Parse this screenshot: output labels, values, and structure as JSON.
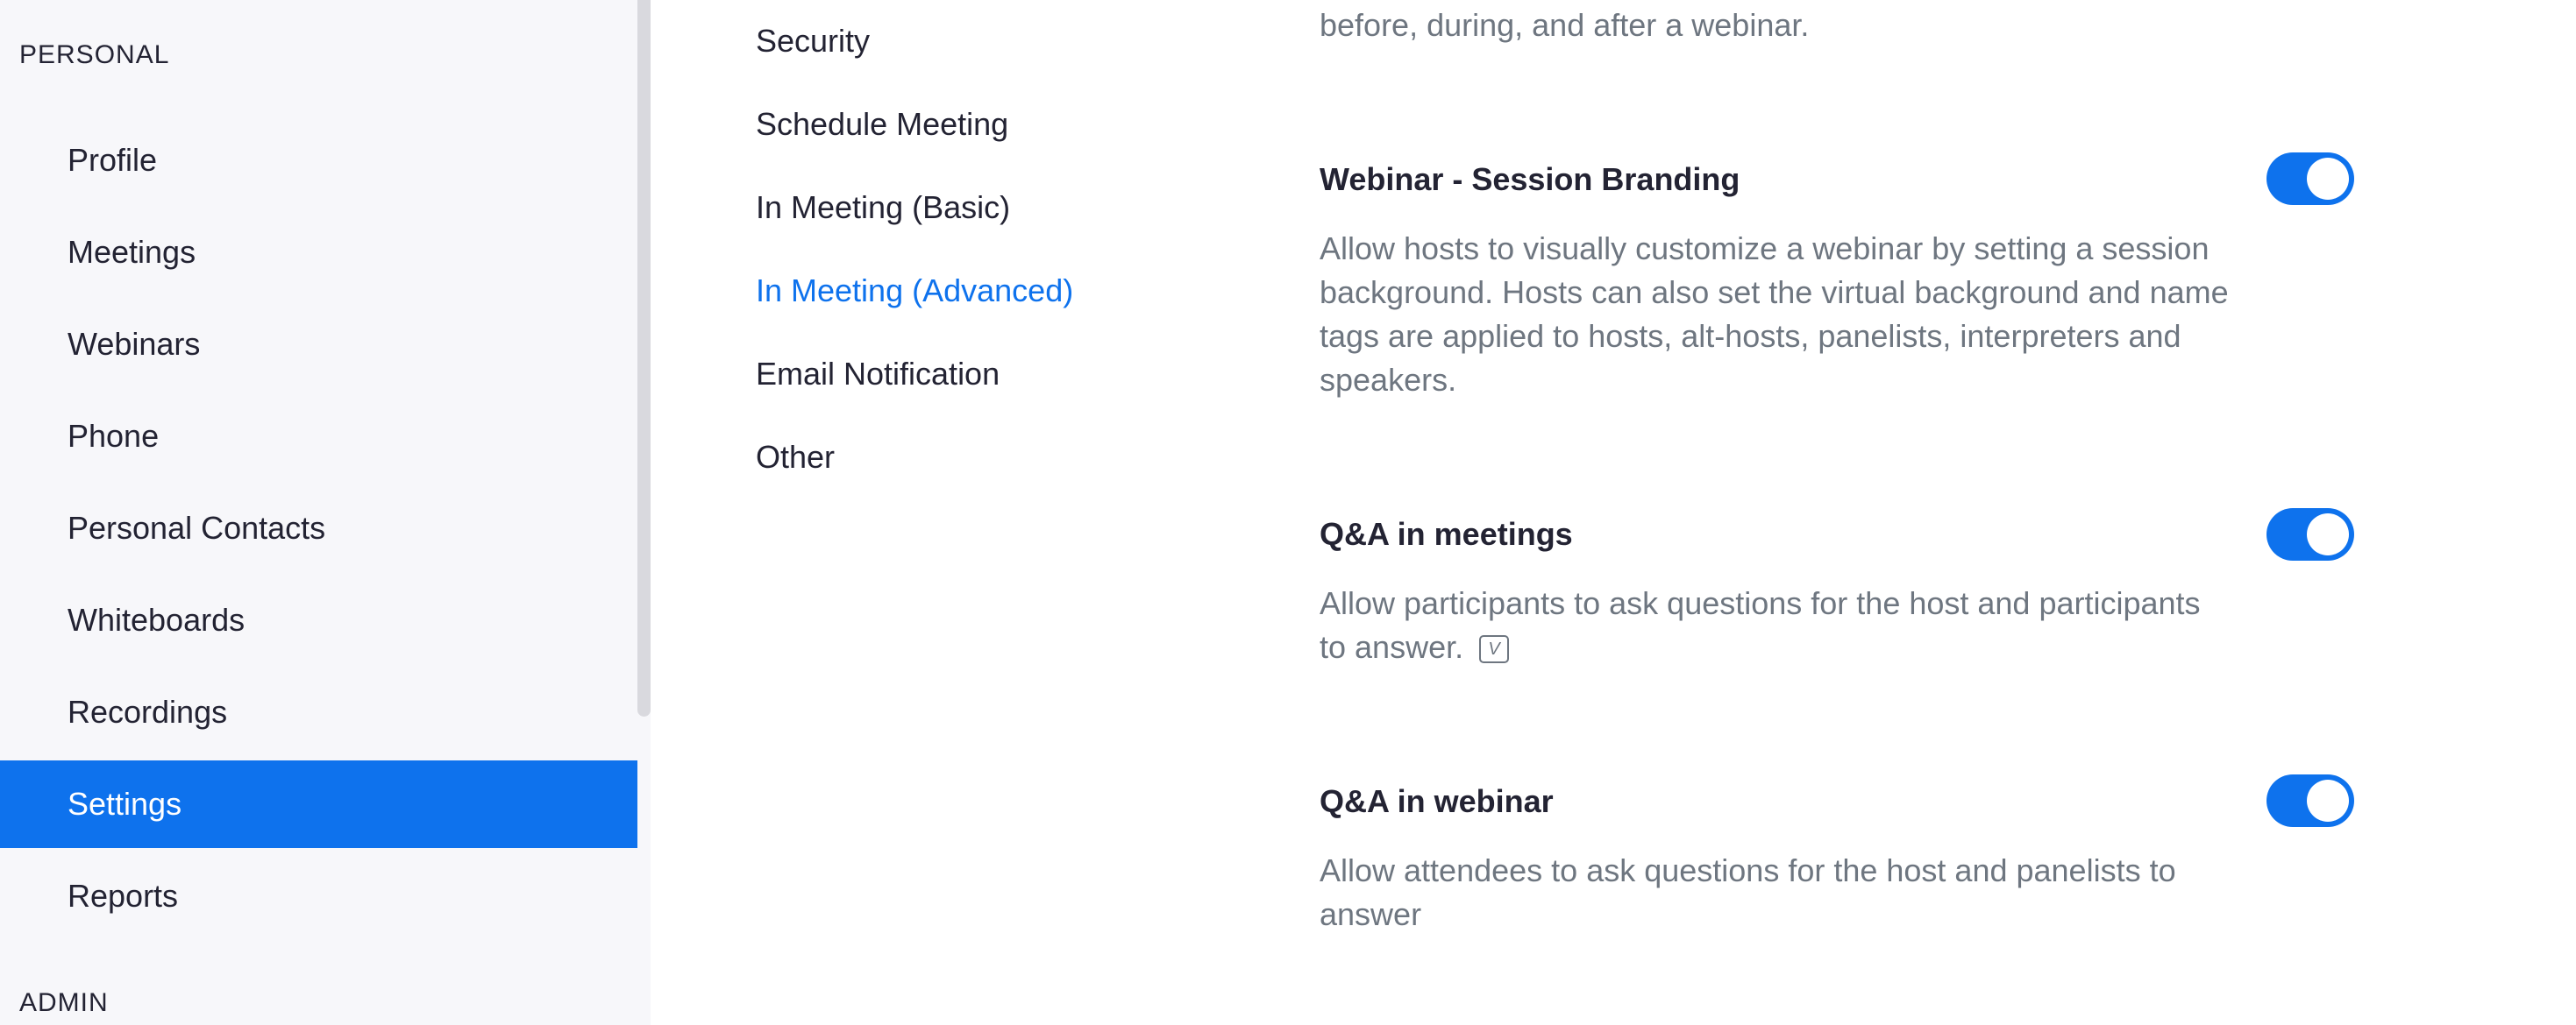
{
  "sidebar": {
    "personal_heading": "PERSONAL",
    "admin_heading": "ADMIN",
    "items": [
      {
        "label": "Profile"
      },
      {
        "label": "Meetings"
      },
      {
        "label": "Webinars"
      },
      {
        "label": "Phone"
      },
      {
        "label": "Personal Contacts"
      },
      {
        "label": "Whiteboards"
      },
      {
        "label": "Recordings"
      },
      {
        "label": "Settings",
        "active": true
      },
      {
        "label": "Reports"
      }
    ]
  },
  "settings_tabs": {
    "items": [
      {
        "label": "Security"
      },
      {
        "label": "Schedule Meeting"
      },
      {
        "label": "In Meeting (Basic)"
      },
      {
        "label": "In Meeting (Advanced)",
        "active": true
      },
      {
        "label": "Email Notification"
      },
      {
        "label": "Other"
      }
    ]
  },
  "content": {
    "partial_description": "before, during, and after a webinar.",
    "settings": [
      {
        "title": "Webinar - Session Branding",
        "description": "Allow hosts to visually customize a webinar by setting a session background. Hosts can also set the virtual background and name tags are applied to hosts, alt-hosts, panelists, interpreters and speakers.",
        "enabled": true
      },
      {
        "title": "Q&A in meetings",
        "description": "Allow participants to ask questions for the host and participants to answer.",
        "info_icon": "version-info-icon",
        "info_glyph": "V",
        "enabled": true
      },
      {
        "title": "Q&A in webinar",
        "description": "Allow attendees to ask questions for the host and panelists to answer",
        "enabled": true
      }
    ]
  },
  "colors": {
    "accent": "#0e72ed",
    "sidebar_bg": "#f7f7fa",
    "text": "#232333",
    "muted_text": "#6e7680"
  }
}
